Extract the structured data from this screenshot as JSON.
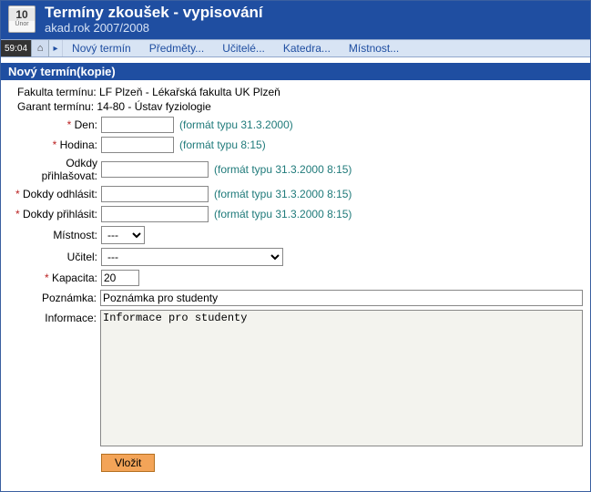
{
  "header": {
    "calendar_icon": {
      "day": "10",
      "month": "Únor"
    },
    "title": "Termíny zkoušek - vypisování",
    "subtitle": "akad.rok 2007/2008"
  },
  "menubar": {
    "time": "59:04",
    "items": [
      "Nový termín",
      "Předměty...",
      "Učitelé...",
      "Katedra...",
      "Místnost..."
    ]
  },
  "panel_title": "Nový termín(kopie)",
  "form": {
    "fakulta_label": "Fakulta termínu:",
    "fakulta_value": "LF Plzeň - Lékařská fakulta UK Plzeň",
    "garant_label": "Garant termínu:",
    "garant_value": "14-80 - Ústav fyziologie",
    "den": {
      "label": "Den:",
      "value": "",
      "hint": "(formát typu 31.3.2000)",
      "required": true
    },
    "hodina": {
      "label": "Hodina:",
      "value": "",
      "hint": "(formát typu 8:15)",
      "required": true
    },
    "odkdy": {
      "label": "Odkdy přihlašovat:",
      "value": "",
      "hint": "(formát typu 31.3.2000 8:15)",
      "required": false
    },
    "dokdy_odhlasit": {
      "label": "Dokdy odhlásit:",
      "value": "",
      "hint": "(formát typu 31.3.2000 8:15)",
      "required": true
    },
    "dokdy_prihlasit": {
      "label": "Dokdy přihlásit:",
      "value": "",
      "hint": "(formát typu 31.3.2000 8:15)",
      "required": true
    },
    "mistnost": {
      "label": "Místnost:",
      "selected": "---"
    },
    "ucitel": {
      "label": "Učitel:",
      "selected": "---"
    },
    "kapacita": {
      "label": "Kapacita:",
      "value": "20",
      "required": true
    },
    "poznamka": {
      "label": "Poznámka:",
      "value": "Poznámka pro studenty"
    },
    "informace": {
      "label": "Informace:",
      "value": "Informace pro studenty"
    },
    "submit_label": "Vložit"
  }
}
